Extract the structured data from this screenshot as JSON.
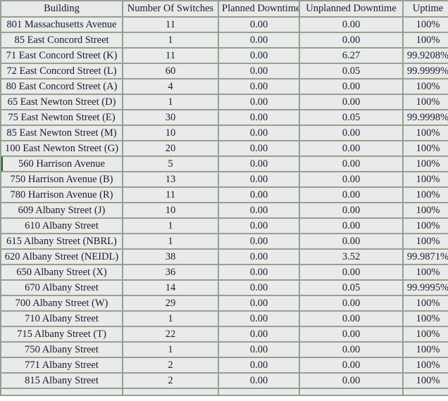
{
  "table": {
    "columns": [
      {
        "key": "building",
        "label": "Building"
      },
      {
        "key": "switches",
        "label": "Number Of Switches"
      },
      {
        "key": "planned",
        "label": "Planned Downtime"
      },
      {
        "key": "unplanned",
        "label": "Unplanned Downtime"
      },
      {
        "key": "uptime",
        "label": "Uptime"
      }
    ],
    "colors": {
      "grid_line": "#8fa391",
      "cell_default": "#eaeaea",
      "cell_tint": "#e7e5ec",
      "cell_alert": "#eeaa9e",
      "selected_marker": "#1f5c36",
      "text": "#1b1b33"
    },
    "rows": [
      {
        "building": "801 Massachusetts Avenue",
        "switches": "11",
        "planned": "0.00",
        "unplanned": "0.00",
        "uptime": "100%",
        "tint": [
          "planned",
          "uptime"
        ],
        "alert": [],
        "selected": false
      },
      {
        "building": "85 East Concord Street",
        "switches": "1",
        "planned": "0.00",
        "unplanned": "0.00",
        "uptime": "100%",
        "tint": [],
        "alert": [],
        "selected": false
      },
      {
        "building": "71 East Concord Street (K)",
        "switches": "11",
        "planned": "0.00",
        "unplanned": "6.27",
        "uptime": "99.9208%",
        "tint": [],
        "alert": [
          "unplanned",
          "uptime"
        ],
        "selected": false
      },
      {
        "building": "72 East Concord Street (L)",
        "switches": "60",
        "planned": "0.00",
        "unplanned": "0.05",
        "uptime": "99.9999%",
        "tint": [
          "planned"
        ],
        "alert": [
          "unplanned",
          "uptime"
        ],
        "selected": false
      },
      {
        "building": "80 East Concord Street (A)",
        "switches": "4",
        "planned": "0.00",
        "unplanned": "0.00",
        "uptime": "100%",
        "tint": [],
        "alert": [],
        "selected": false
      },
      {
        "building": "65 East Newton Street (D)",
        "switches": "1",
        "planned": "0.00",
        "unplanned": "0.00",
        "uptime": "100%",
        "tint": [],
        "alert": [],
        "selected": false
      },
      {
        "building": "75 East Newton Street (E)",
        "switches": "30",
        "planned": "0.00",
        "unplanned": "0.05",
        "uptime": "99.9998%",
        "tint": [],
        "alert": [
          "unplanned",
          "uptime"
        ],
        "selected": false
      },
      {
        "building": "85 East Newton Street (M)",
        "switches": "10",
        "planned": "0.00",
        "unplanned": "0.00",
        "uptime": "100%",
        "tint": [],
        "alert": [],
        "selected": false
      },
      {
        "building": "100 East Newton Street (G)",
        "switches": "20",
        "planned": "0.00",
        "unplanned": "0.00",
        "uptime": "100%",
        "tint": [],
        "alert": [],
        "selected": false
      },
      {
        "building": "560 Harrison Avenue",
        "switches": "5",
        "planned": "0.00",
        "unplanned": "0.00",
        "uptime": "100%",
        "tint": [
          "planned",
          "uptime"
        ],
        "alert": [],
        "selected": true
      },
      {
        "building": "750 Harrison Avenue (B)",
        "switches": "13",
        "planned": "0.00",
        "unplanned": "0.00",
        "uptime": "100%",
        "tint": [
          "unplanned",
          "uptime"
        ],
        "alert": [],
        "selected": false
      },
      {
        "building": "780 Harrison Avenue (R)",
        "switches": "11",
        "planned": "0.00",
        "unplanned": "0.00",
        "uptime": "100%",
        "tint": [],
        "alert": [],
        "selected": false
      },
      {
        "building": "609 Albany Street (J)",
        "switches": "10",
        "planned": "0.00",
        "unplanned": "0.00",
        "uptime": "100%",
        "tint": [
          "unplanned",
          "uptime"
        ],
        "alert": [],
        "selected": false
      },
      {
        "building": "610 Albany Street",
        "switches": "1",
        "planned": "0.00",
        "unplanned": "0.00",
        "uptime": "100%",
        "tint": [
          "planned",
          "uptime"
        ],
        "alert": [],
        "selected": false
      },
      {
        "building": "615 Albany Street (NBRL)",
        "switches": "1",
        "planned": "0.00",
        "unplanned": "0.00",
        "uptime": "100%",
        "tint": [],
        "alert": [],
        "selected": false
      },
      {
        "building": "620 Albany Street (NEIDL)",
        "switches": "38",
        "planned": "0.00",
        "unplanned": "3.52",
        "uptime": "99.9871%",
        "tint": [],
        "alert": [
          "unplanned",
          "uptime"
        ],
        "selected": false
      },
      {
        "building": "650 Albany Street (X)",
        "switches": "36",
        "planned": "0.00",
        "unplanned": "0.00",
        "uptime": "100%",
        "tint": [
          "planned",
          "uptime"
        ],
        "alert": [],
        "selected": false
      },
      {
        "building": "670 Albany Street",
        "switches": "14",
        "planned": "0.00",
        "unplanned": "0.05",
        "uptime": "99.9995%",
        "tint": [
          "planned"
        ],
        "alert": [
          "unplanned",
          "uptime"
        ],
        "selected": false
      },
      {
        "building": "700 Albany Street (W)",
        "switches": "29",
        "planned": "0.00",
        "unplanned": "0.00",
        "uptime": "100%",
        "tint": [
          "planned",
          "uptime"
        ],
        "alert": [],
        "selected": false
      },
      {
        "building": "710 Albany Street",
        "switches": "1",
        "planned": "0.00",
        "unplanned": "0.00",
        "uptime": "100%",
        "tint": [
          "planned",
          "uptime"
        ],
        "alert": [],
        "selected": false
      },
      {
        "building": "715 Albany Street (T)",
        "switches": "22",
        "planned": "0.00",
        "unplanned": "0.00",
        "uptime": "100%",
        "tint": [
          "unplanned",
          "uptime"
        ],
        "alert": [],
        "selected": false
      },
      {
        "building": "750 Albany Street",
        "switches": "1",
        "planned": "0.00",
        "unplanned": "0.00",
        "uptime": "100%",
        "tint": [
          "planned",
          "uptime"
        ],
        "alert": [],
        "selected": false
      },
      {
        "building": "771 Albany Street",
        "switches": "2",
        "planned": "0.00",
        "unplanned": "0.00",
        "uptime": "100%",
        "tint": [
          "planned",
          "unplanned",
          "uptime"
        ],
        "alert": [],
        "selected": false
      },
      {
        "building": "815 Albany Street",
        "switches": "2",
        "planned": "0.00",
        "unplanned": "0.00",
        "uptime": "100%",
        "tint": [
          "uptime"
        ],
        "alert": [],
        "selected": false
      }
    ]
  }
}
